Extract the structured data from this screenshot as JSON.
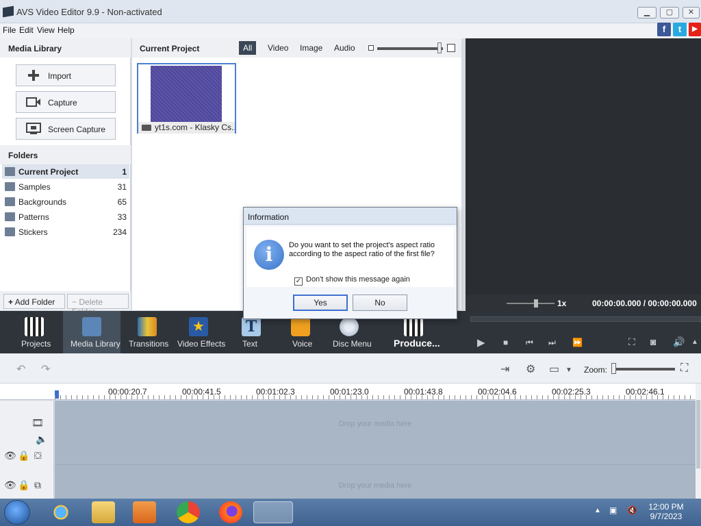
{
  "window": {
    "title": "AVS Video Editor 9.9 - Non-activated",
    "minimize": "▁",
    "maximize": "▢",
    "close": "✕"
  },
  "menu": [
    "File",
    "Edit",
    "View",
    "Help"
  ],
  "social": {
    "facebook": "f",
    "twitter": "t",
    "youtube": "▶",
    "colors": {
      "facebook": "#3b5998",
      "twitter": "#2aa9e0",
      "youtube": "#e62117"
    }
  },
  "media_library": {
    "title": "Media Library",
    "buttons": {
      "import": "Import",
      "capture": "Capture",
      "screen_capture": "Screen Capture"
    },
    "folders_title": "Folders",
    "folders": [
      {
        "name": "Current Project",
        "count": "1"
      },
      {
        "name": "Samples",
        "count": "31"
      },
      {
        "name": "Backgrounds",
        "count": "65"
      },
      {
        "name": "Patterns",
        "count": "33"
      },
      {
        "name": "Stickers",
        "count": "234"
      }
    ],
    "add_folder": "Add Folder",
    "delete_folder": "Delete Folder"
  },
  "project": {
    "title": "Current Project",
    "filters": [
      "All",
      "Video",
      "Image",
      "Audio"
    ],
    "items": [
      {
        "caption": "yt1s.com - Klasky Cs..."
      }
    ]
  },
  "preview": {
    "speed": "1x",
    "time": "00:00:00.000  /  00:00:00.000"
  },
  "toolbar": {
    "tools": [
      "Projects",
      "Media Library",
      "Transitions",
      "Video Effects",
      "Text",
      "Voice",
      "Disc Menu"
    ],
    "produce": "Produce..."
  },
  "timeline": {
    "zoom_label": "Zoom:",
    "ruler": [
      "00:00:20.7",
      "00:00:41.5",
      "00:01:02.3",
      "00:01:23.0",
      "00:01:43.8",
      "00:02:04.6",
      "00:02:25.3",
      "00:02:46.1"
    ],
    "drop_text": "Drop your media here"
  },
  "dialog": {
    "title": "Information",
    "message": "Do you want to set the project's aspect ratio according to the aspect ratio of the first file?",
    "checkbox_label": "Don't show this message again",
    "checked": true,
    "yes": "Yes",
    "no": "No"
  },
  "taskbar": {
    "time": "12:00 PM",
    "date": "9/7/2023"
  }
}
